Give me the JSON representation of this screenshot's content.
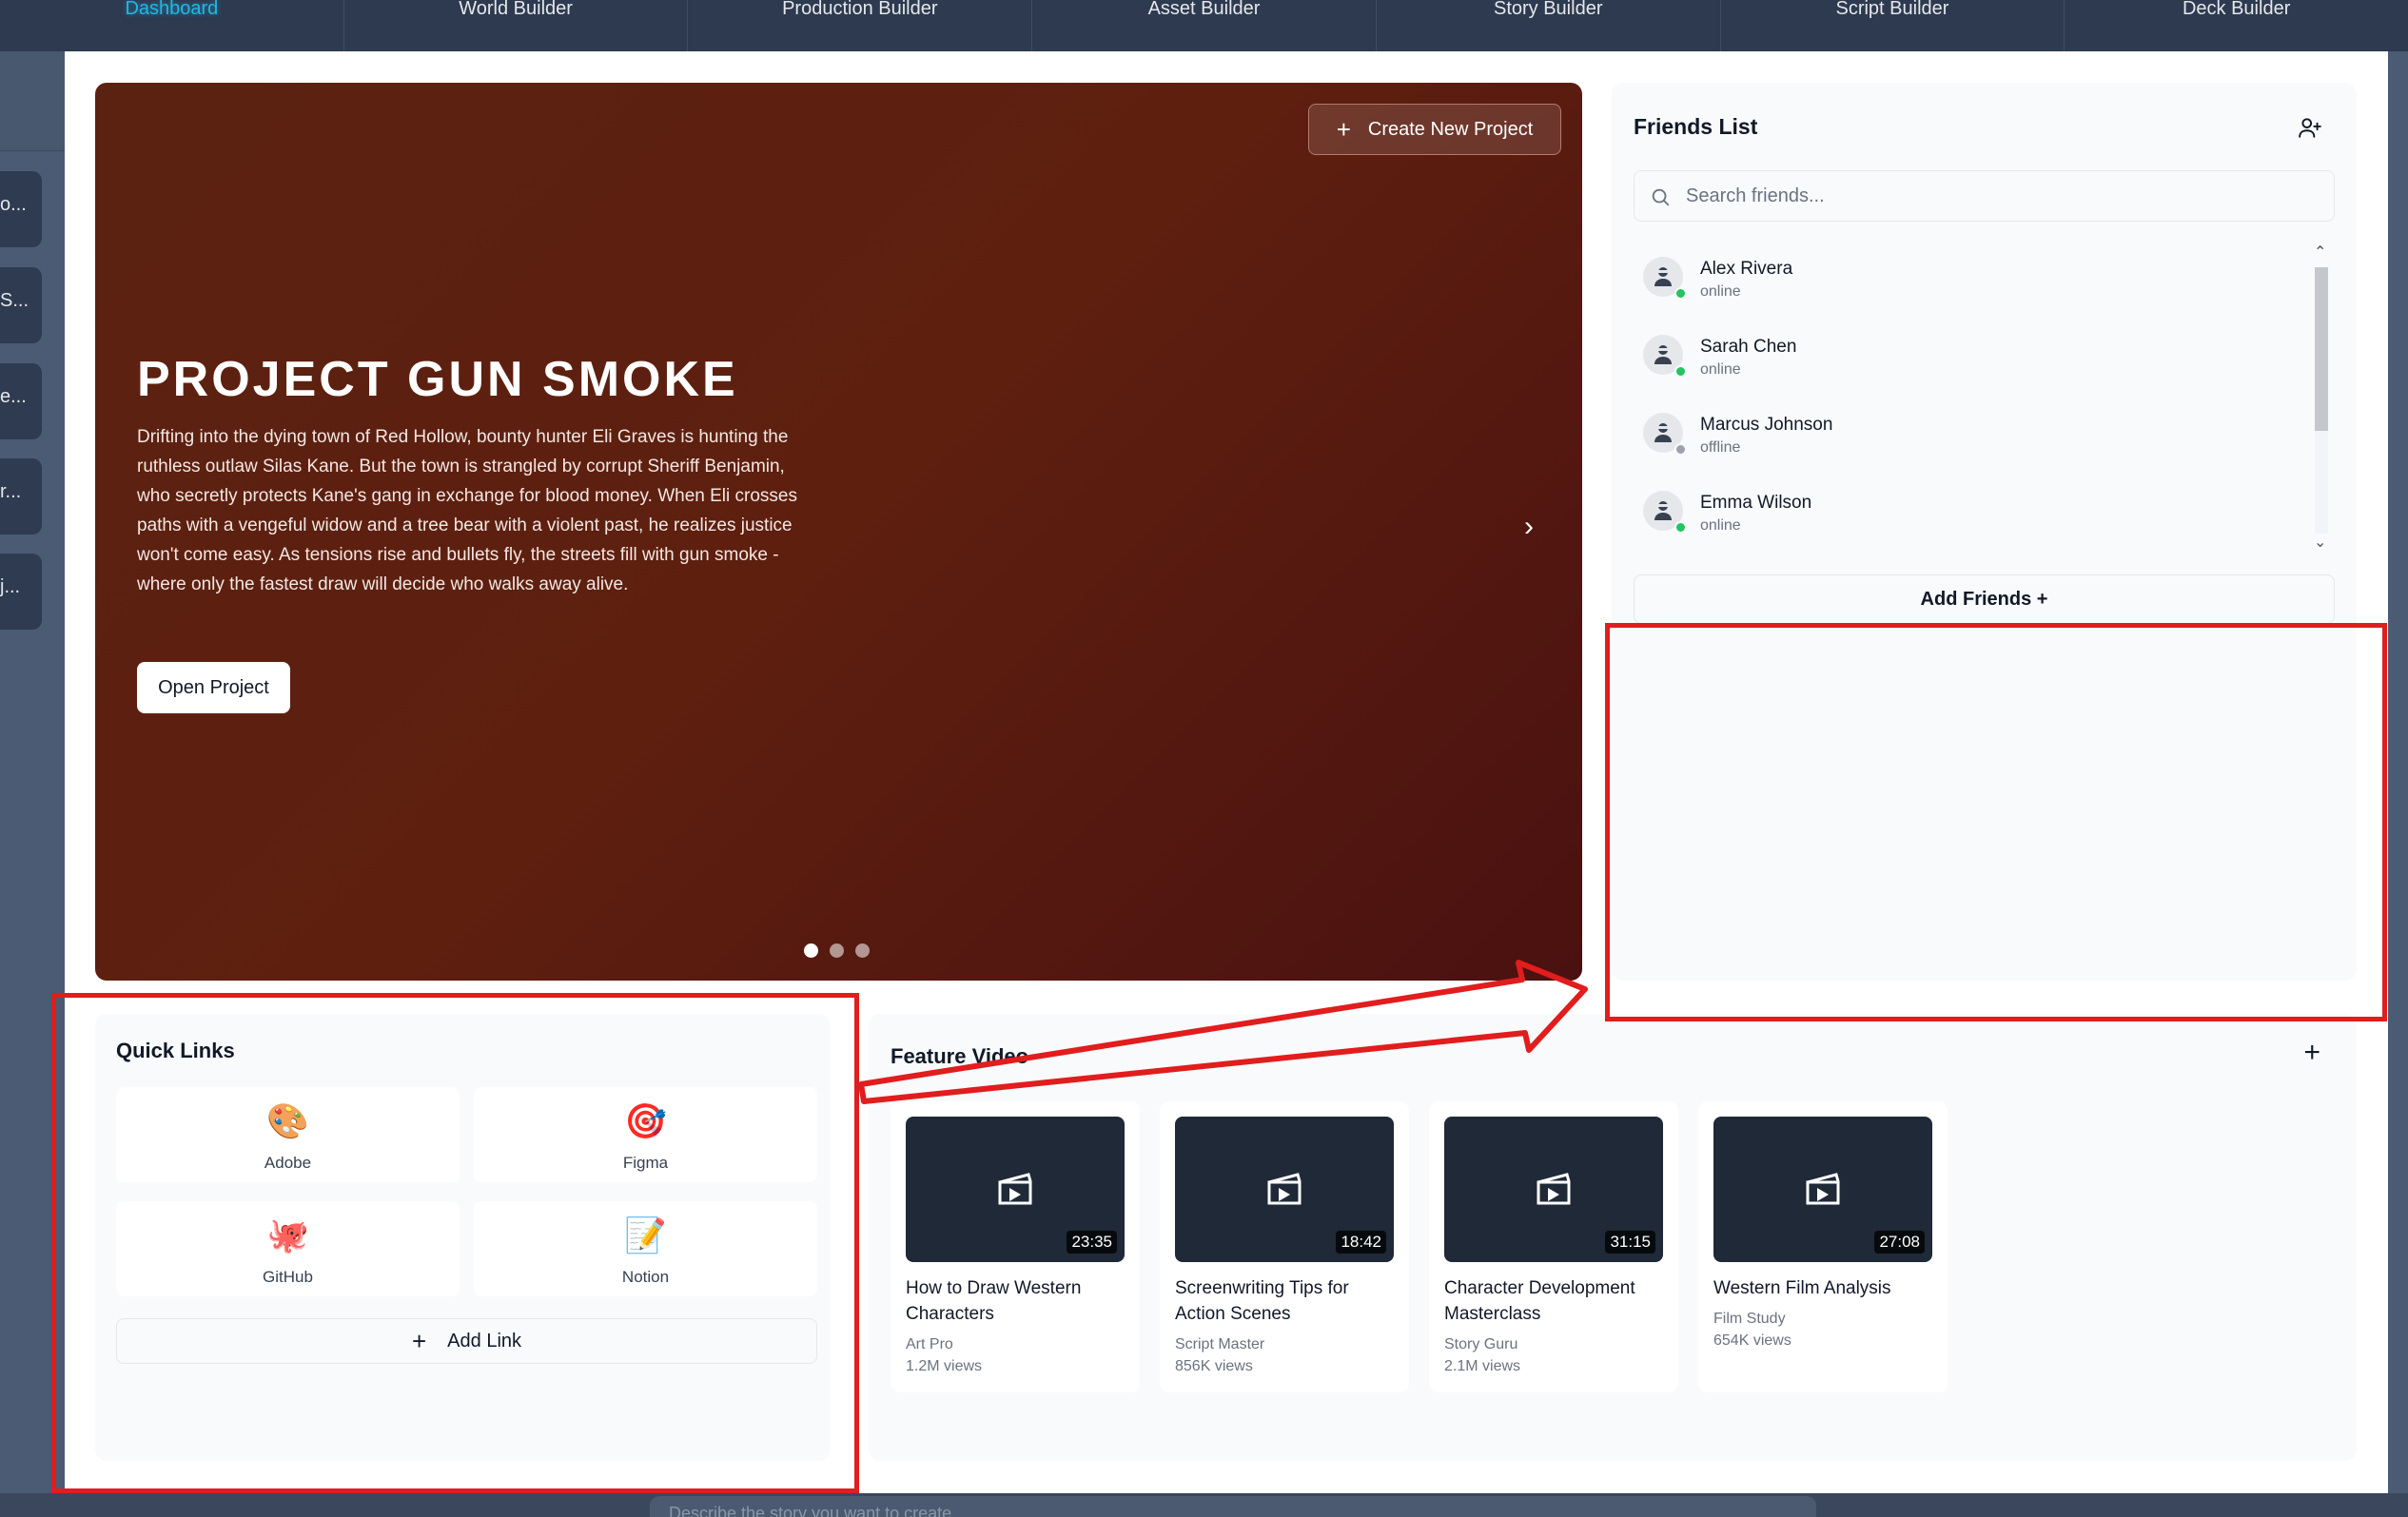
{
  "nav": {
    "items": [
      {
        "label": "Dashboard",
        "active": true
      },
      {
        "label": "World Builder"
      },
      {
        "label": "Production Builder"
      },
      {
        "label": "Asset Builder"
      },
      {
        "label": "Story Builder"
      },
      {
        "label": "Script Builder"
      },
      {
        "label": "Deck Builder"
      }
    ]
  },
  "left_rail": {
    "items": [
      "o...",
      "S...",
      "e...",
      "r...",
      "j..."
    ]
  },
  "hero": {
    "create_label": "Create New Project",
    "title": "PROJECT GUN SMOKE",
    "description": "Drifting into the dying town of Red Hollow, bounty hunter Eli Graves is hunting the ruthless outlaw Silas Kane. But the town is strangled by corrupt Sheriff Benjamin, who secretly protects Kane's gang in exchange for blood money. When Eli crosses paths with a vengeful widow and a tree bear with a violent past, he realizes justice won't come easy. As tensions rise and bullets fly, the streets fill with gun smoke - where only the fastest draw will decide who walks away alive.",
    "open_label": "Open Project",
    "slides_total": 3,
    "active_slide": 1
  },
  "friends": {
    "title": "Friends List",
    "search_placeholder": "Search friends...",
    "items": [
      {
        "name": "Alex Rivera",
        "status": "online"
      },
      {
        "name": "Sarah Chen",
        "status": "online"
      },
      {
        "name": "Marcus Johnson",
        "status": "offline"
      },
      {
        "name": "Emma Wilson",
        "status": "online"
      }
    ],
    "add_label": "Add Friends +"
  },
  "quick_links": {
    "title": "Quick Links",
    "items": [
      {
        "label": "Adobe",
        "icon": "🎨"
      },
      {
        "label": "Figma",
        "icon": "🎯"
      },
      {
        "label": "GitHub",
        "icon": "🐙"
      },
      {
        "label": "Notion",
        "icon": "📝"
      }
    ],
    "add_label": "Add Link"
  },
  "feature_video": {
    "title": "Feature Video",
    "videos": [
      {
        "title": "How to Draw Western Characters",
        "author": "Art Pro",
        "views": "1.2M views",
        "duration": "23:35"
      },
      {
        "title": "Screenwriting Tips for Action Scenes",
        "author": "Script Master",
        "views": "856K views",
        "duration": "18:42"
      },
      {
        "title": "Character Development Masterclass",
        "author": "Story Guru",
        "views": "2.1M views",
        "duration": "31:15"
      },
      {
        "title": "Western Film Analysis",
        "author": "Film Study",
        "views": "654K views",
        "duration": "27:08"
      }
    ]
  },
  "prompt": {
    "placeholder": "Describe the story you want to create..."
  },
  "colors": {
    "nav_bg": "#2d3a4f",
    "active_nav": "#22b8e6",
    "hero_bg": "#5b2211",
    "online": "#22c55e",
    "offline": "#9ca3af",
    "annotation": "#e11d1d"
  }
}
